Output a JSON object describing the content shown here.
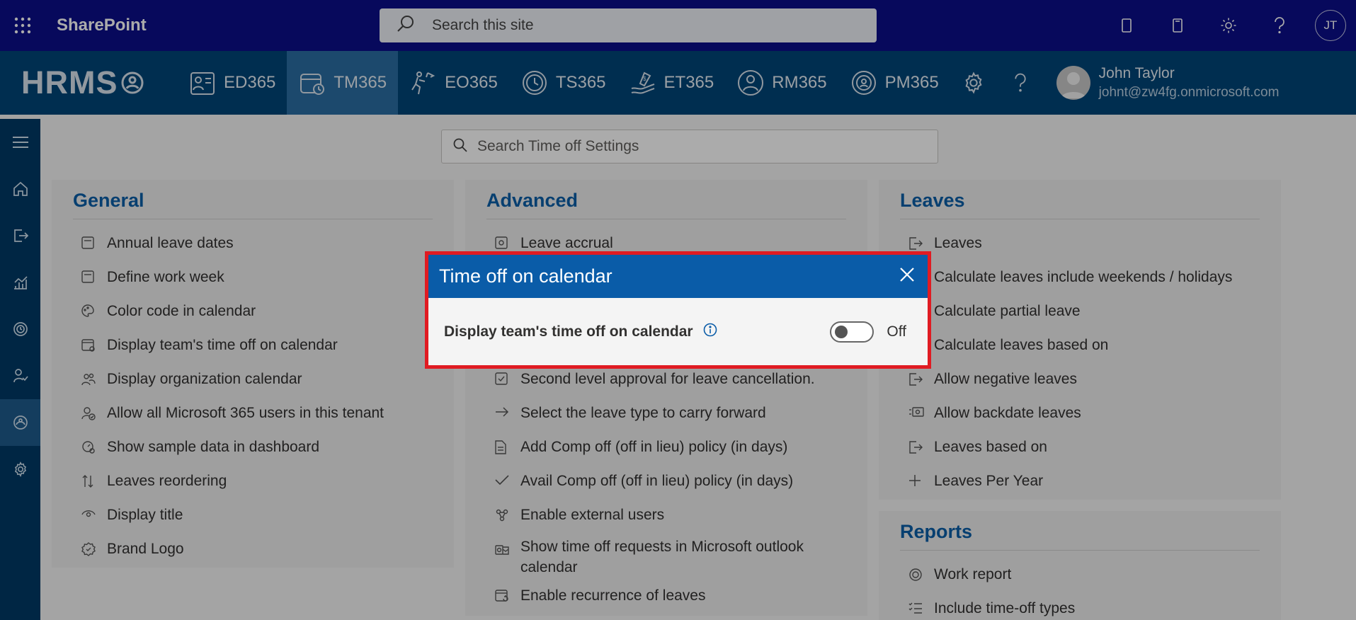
{
  "sharepoint": {
    "title": "SharePoint",
    "search_placeholder": "Search this site",
    "user_initials": "JT"
  },
  "hrms": {
    "logo": "HRMS",
    "tabs": [
      {
        "label": "ED365",
        "icon": "employee-directory-icon"
      },
      {
        "label": "TM365",
        "icon": "calendar-time-icon",
        "active": true
      },
      {
        "label": "EO365",
        "icon": "onboarding-icon"
      },
      {
        "label": "TS365",
        "icon": "clock-icon"
      },
      {
        "label": "ET365",
        "icon": "expense-icon"
      },
      {
        "label": "RM365",
        "icon": "recruitment-icon"
      },
      {
        "label": "PM365",
        "icon": "performance-icon"
      }
    ],
    "user": {
      "name": "John Taylor",
      "email": "johnt@zw4fg.onmicrosoft.com"
    }
  },
  "settings_search": {
    "placeholder": "Search Time off Settings"
  },
  "general": {
    "title": "General",
    "items": [
      "Annual leave dates",
      "Define work week",
      "Color code in calendar",
      "Display team's time off on calendar",
      "Display organization calendar",
      "Allow all Microsoft 365 users in this tenant",
      "Show sample data in dashboard",
      "Leaves reordering",
      "Display title",
      "Brand Logo"
    ]
  },
  "advanced": {
    "title": "Advanced",
    "items": [
      "Leave accrual",
      "Second level approval for leave cancellation.",
      "Select the leave type to carry forward",
      "Add Comp off (off in lieu) policy (in days)",
      "Avail Comp off (off in lieu) policy (in days)",
      "Enable external users",
      "Show time off requests in Microsoft outlook calendar",
      "Enable recurrence of leaves"
    ]
  },
  "leaves": {
    "title": "Leaves",
    "items": [
      "Leaves",
      "Calculate leaves include weekends / holidays",
      "Calculate partial leave",
      "Calculate leaves based on",
      "Allow negative leaves",
      "Allow backdate leaves",
      "Leaves based on",
      "Leaves Per Year"
    ]
  },
  "reports": {
    "title": "Reports",
    "items": [
      "Work report",
      "Include time-off types"
    ]
  },
  "modal": {
    "title": "Time off on calendar",
    "setting_label": "Display team's time off on calendar",
    "toggle_state": "Off"
  },
  "colors": {
    "sharepoint_bar": "#0b0e8a",
    "hrms_bar": "#004578",
    "accent": "#0b5ea8",
    "highlight_border": "#e01b22"
  }
}
